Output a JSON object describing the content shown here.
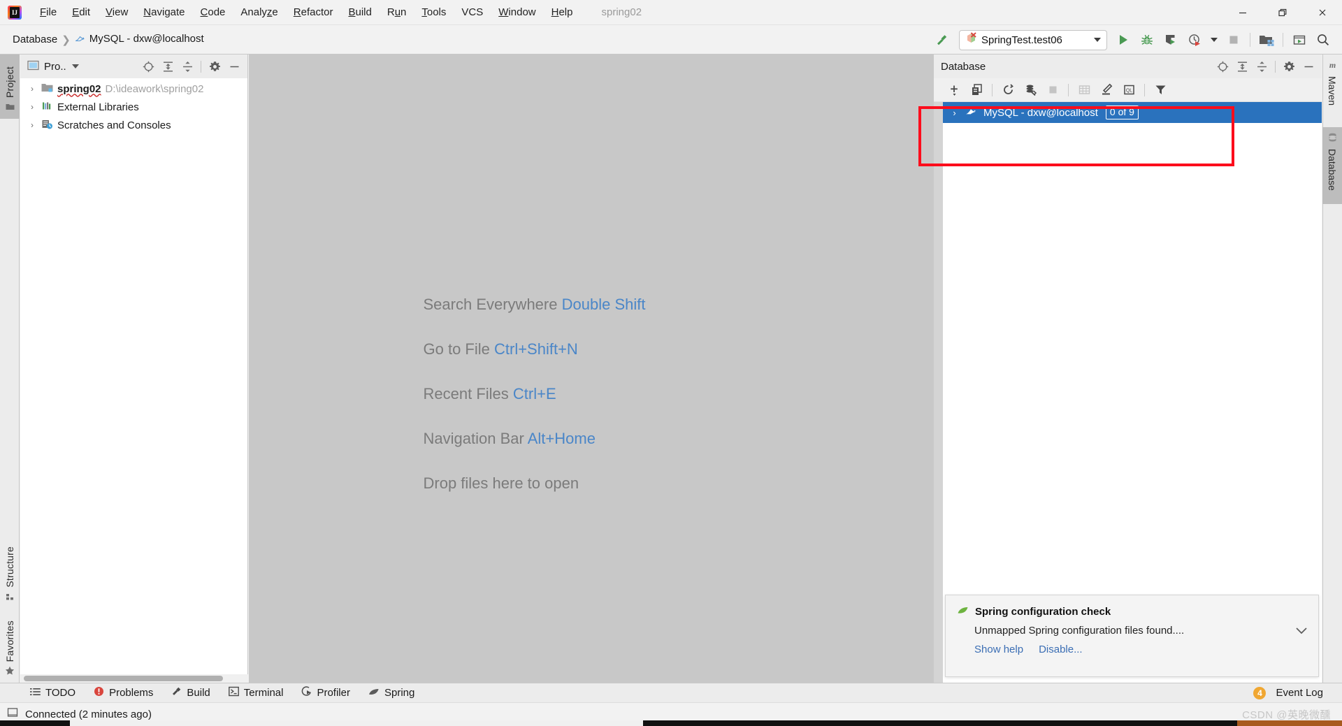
{
  "window": {
    "project_name": "spring02",
    "controls": {
      "minimize": "minimize-icon",
      "maximize": "maximize-icon",
      "close": "close-icon"
    }
  },
  "menu": {
    "items": [
      {
        "label": "File",
        "mnemonic": "F"
      },
      {
        "label": "Edit",
        "mnemonic": "E"
      },
      {
        "label": "View",
        "mnemonic": "V"
      },
      {
        "label": "Navigate",
        "mnemonic": "N"
      },
      {
        "label": "Code",
        "mnemonic": "C"
      },
      {
        "label": "Analyze",
        "mnemonic": "z"
      },
      {
        "label": "Refactor",
        "mnemonic": "R"
      },
      {
        "label": "Build",
        "mnemonic": "B"
      },
      {
        "label": "Run",
        "mnemonic": "u"
      },
      {
        "label": "Tools",
        "mnemonic": "T"
      },
      {
        "label": "VCS",
        "mnemonic": ""
      },
      {
        "label": "Window",
        "mnemonic": "W"
      },
      {
        "label": "Help",
        "mnemonic": "H"
      }
    ]
  },
  "navbar": {
    "breadcrumbs": [
      {
        "label": "Database",
        "icon": ""
      },
      {
        "label": "MySQL - dxw@localhost",
        "icon": "mysql-dolphin-icon"
      }
    ],
    "run_config": {
      "label": "SpringTest.test06",
      "icon": "test-failed-icon"
    },
    "buttons": [
      {
        "name": "build-hammer-button",
        "icon": "hammer-icon"
      },
      {
        "name": "run-button",
        "icon": "play-icon"
      },
      {
        "name": "debug-button",
        "icon": "debug-bug-icon"
      },
      {
        "name": "run-with-coverage-button",
        "icon": "coverage-shield-icon"
      },
      {
        "name": "profiler-button",
        "icon": "profiler-clock-icon"
      },
      {
        "name": "profiler-dropdown",
        "icon": "chevron-down-icon"
      },
      {
        "name": "stop-button",
        "icon": "stop-square-icon"
      },
      {
        "name": "project-structure-button",
        "icon": "project-structure-icon"
      },
      {
        "name": "updates-button",
        "icon": "window-play-icon"
      },
      {
        "name": "search-everywhere-button",
        "icon": "search-icon"
      }
    ]
  },
  "left_strip": {
    "tabs": [
      {
        "label": "Project",
        "icon": "project-folder-icon",
        "active": true
      },
      {
        "label": "Structure",
        "icon": "structure-icon",
        "active": false
      },
      {
        "label": "Favorites",
        "icon": "star-icon",
        "active": false
      }
    ]
  },
  "right_strip": {
    "tabs": [
      {
        "label": "Maven",
        "icon": "maven-m-icon",
        "active": false
      },
      {
        "label": "Database",
        "icon": "database-icon",
        "active": true
      }
    ]
  },
  "project_window": {
    "title": "Pro..",
    "actions": [
      {
        "name": "select-opened-file-button",
        "icon": "target-icon"
      },
      {
        "name": "expand-all-button",
        "icon": "expand-all-icon"
      },
      {
        "name": "collapse-all-button",
        "icon": "collapse-all-icon"
      },
      {
        "name": "settings-button",
        "icon": "gear-icon"
      },
      {
        "name": "hide-button",
        "icon": "minimize-icon"
      }
    ],
    "tree": [
      {
        "name": "spring02",
        "path": "D:\\ideawork\\spring02",
        "icon": "module-folder-icon",
        "bold": true,
        "arrow": "›"
      },
      {
        "name": "External Libraries",
        "path": "",
        "icon": "libraries-icon",
        "bold": false,
        "arrow": "›"
      },
      {
        "name": "Scratches and Consoles",
        "path": "",
        "icon": "scratches-icon",
        "bold": false,
        "arrow": "›"
      }
    ]
  },
  "editor": {
    "tips": [
      {
        "action": "Search Everywhere",
        "key": "Double Shift"
      },
      {
        "action": "Go to File",
        "key": "Ctrl+Shift+N"
      },
      {
        "action": "Recent Files",
        "key": "Ctrl+E"
      },
      {
        "action": "Navigation Bar",
        "key": "Alt+Home"
      },
      {
        "action": "Drop files here to open",
        "key": ""
      }
    ]
  },
  "database_window": {
    "title": "Database",
    "header_actions": [
      {
        "name": "scroll-from-source-button",
        "icon": "target-icon"
      },
      {
        "name": "expand-all-button",
        "icon": "expand-all-icon"
      },
      {
        "name": "collapse-all-button",
        "icon": "collapse-all-icon"
      },
      {
        "name": "settings-button",
        "icon": "gear-icon"
      },
      {
        "name": "hide-button",
        "icon": "minimize-icon"
      }
    ],
    "toolbar_actions": [
      {
        "name": "new-button",
        "icon": "plus-icon",
        "disabled": false
      },
      {
        "name": "duplicate-button",
        "icon": "copy-icon",
        "disabled": false
      },
      {
        "name": "refresh-button",
        "icon": "refresh-icon",
        "disabled": false
      },
      {
        "name": "synchronize-button",
        "icon": "db-sync-icon",
        "disabled": false
      },
      {
        "name": "stop-button",
        "icon": "stop-square-icon",
        "disabled": true
      },
      {
        "name": "jump-to-data-button",
        "icon": "table-grid-icon",
        "disabled": true
      },
      {
        "name": "modify-button",
        "icon": "pencil-icon",
        "disabled": false
      },
      {
        "name": "open-console-button",
        "icon": "sql-console-icon",
        "disabled": false
      },
      {
        "name": "filter-button",
        "icon": "filter-icon",
        "disabled": false
      }
    ],
    "rows": [
      {
        "label": "MySQL - dxw@localhost",
        "badge": "0 of 9",
        "icon": "mysql-dolphin-icon",
        "arrow": "›",
        "selected": true
      }
    ],
    "highlight": {
      "color": "#fc0d1c"
    }
  },
  "notification": {
    "icon": "spring-leaf-icon",
    "title": "Spring configuration check",
    "body": "Unmapped Spring configuration files found....",
    "links": [
      "Show help",
      "Disable..."
    ],
    "collapse_icon": "chevron-down-icon"
  },
  "bottom_bar": {
    "tabs": [
      {
        "label": "TODO",
        "icon": "todo-list-icon"
      },
      {
        "label": "Problems",
        "icon": "problems-error-icon"
      },
      {
        "label": "Build",
        "icon": "hammer-icon"
      },
      {
        "label": "Terminal",
        "icon": "terminal-icon"
      },
      {
        "label": "Profiler",
        "icon": "profiler-icon"
      },
      {
        "label": "Spring",
        "icon": "spring-leaf-icon"
      }
    ],
    "event_log": {
      "label": "Event Log",
      "count": "4"
    }
  },
  "status_bar": {
    "icon": "db-connected-icon",
    "text": "Connected (2 minutes ago)",
    "watermark": "CSDN @英晚微醺"
  },
  "colors": {
    "accent_selection": "#2a72bd",
    "highlight_red": "#fc0d1c",
    "link_blue": "#3b6eb4",
    "tip_key_blue": "#4a86c8",
    "badge_orange": "#f0a732",
    "editor_bg": "#c8c8c8"
  }
}
